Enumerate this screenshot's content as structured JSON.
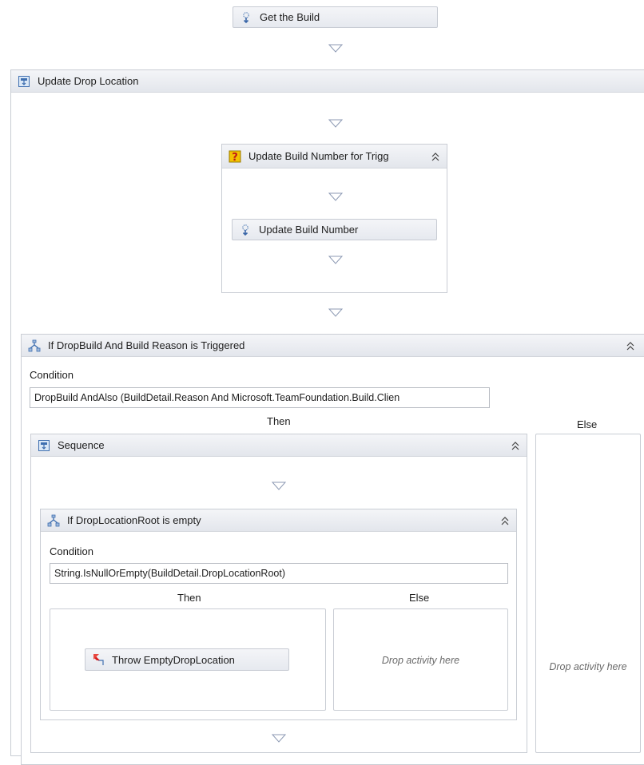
{
  "activities": {
    "get_build": "Get the Build",
    "update_drop_location": "Update Drop Location",
    "update_build_number_trigger": "Update Build Number for Trigg",
    "update_build_number": "Update Build Number",
    "if_dropbuild": "If DropBuild And Build Reason is Triggered",
    "sequence": "Sequence",
    "if_droplocationroot": "If DropLocationRoot is empty",
    "throw_empty_drop": "Throw EmptyDropLocation"
  },
  "outer_if": {
    "condition_label": "Condition",
    "condition_value": "DropBuild AndAlso (BuildDetail.Reason And Microsoft.TeamFoundation.Build.Clien",
    "then_label": "Then",
    "else_label": "Else",
    "else_hint": "Drop activity here"
  },
  "inner_if": {
    "condition_label": "Condition",
    "condition_value": "String.IsNullOrEmpty(BuildDetail.DropLocationRoot)",
    "then_label": "Then",
    "else_label": "Else",
    "else_hint": "Drop activity here"
  },
  "colors": {
    "activity_bg": "#e6e9ef",
    "border": "#c9cdd4",
    "arrow": "#8c99b3"
  },
  "icons": [
    "activity-icon",
    "sequence-icon",
    "question-icon",
    "if-icon",
    "throw-icon",
    "collapse-chevron-icon",
    "flow-arrow-icon"
  ]
}
